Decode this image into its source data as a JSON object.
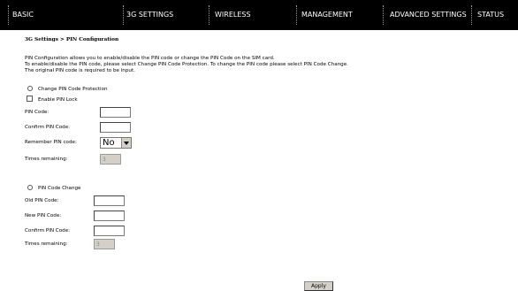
{
  "nav": {
    "basic": "BASIC",
    "settings_3g": "3G SETTINGS",
    "wireless": "WIRELESS",
    "management": "MANAGEMENT",
    "advanced": "ADVANCED SETTINGS",
    "status": "STATUS"
  },
  "breadcrumb": "3G Settings > PIN Configuration",
  "description": [
    "PIN Configuration allows you to enable/disable the PIN code or change the PIN Code on the SIM card.",
    "To enable/disable the PIN code, please select Change PIN Code Protection. To change the PIN code please select PIN Code Change.",
    "The original PIN code is required to be input."
  ],
  "protection": {
    "radio_label": "Change PIN Code Protection",
    "enable_lock_label": "Enable PIN Lock",
    "pin_code_label": "PIN Code:",
    "confirm_pin_label": "Confirm PIN Code:",
    "remember_label": "Remember PIN code:",
    "remember_value": "No",
    "times_label": "Times remaining:",
    "times_value": "3"
  },
  "change": {
    "radio_label": "PIN Code Change",
    "old_pin_label": "Old PIN Code:",
    "new_pin_label": "New PIN Code:",
    "confirm_pin_label": "Confirm PIN Code:",
    "times_label": "Times remaining:",
    "times_value": "3"
  },
  "apply_label": "Apply"
}
